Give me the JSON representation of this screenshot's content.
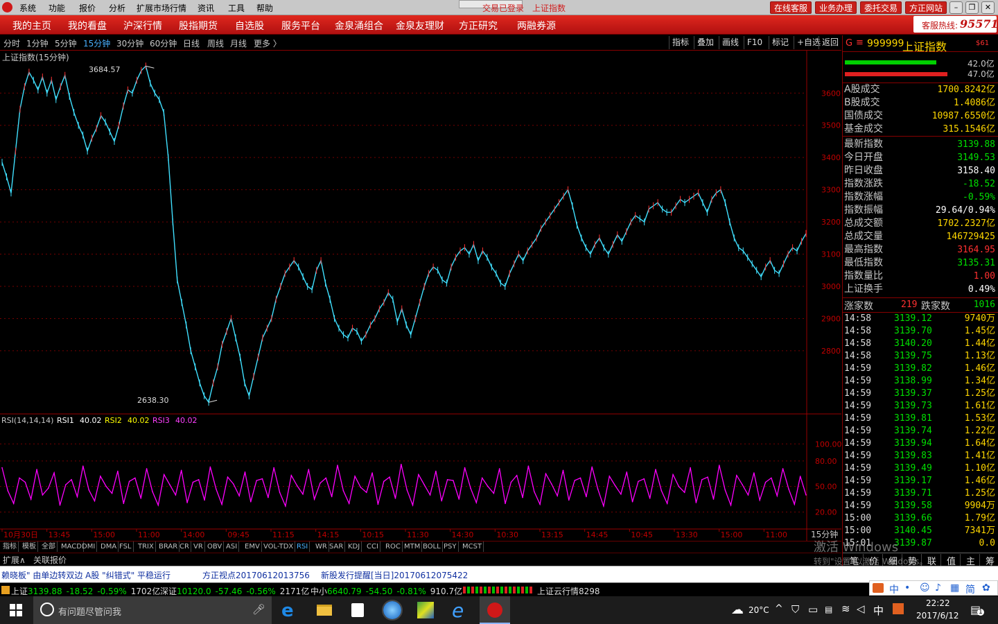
{
  "titlebar": {
    "menus": [
      "系统",
      "功能",
      "报价",
      "分析",
      "扩展市场行情",
      "资讯",
      "工具",
      "帮助"
    ],
    "status": "交易已登录",
    "current": "上证指数",
    "buttons": [
      "在线客服",
      "业务办理",
      "委托交易",
      "方正网站"
    ]
  },
  "nav": {
    "items": [
      "我的主页",
      "我的看盘",
      "沪深行情",
      "股指期货",
      "自选股",
      "服务平台",
      "金泉涌组合",
      "金泉友理财",
      "方正研究",
      "两融券源"
    ],
    "hotline_label": "客服热线:",
    "hotline": "95571"
  },
  "periods": {
    "items": [
      "分时",
      "1分钟",
      "5分钟",
      "15分钟",
      "30分钟",
      "60分钟",
      "日线",
      "周线",
      "月线",
      "更多 〉"
    ],
    "active": "15分钟",
    "tools": [
      "指标",
      "叠加",
      "画线",
      "F10",
      "标记",
      "+自选",
      "返回"
    ]
  },
  "chart_data": [
    {
      "type": "line",
      "title": "上证指数(15分钟)",
      "ylim": [
        2638.3,
        3684.57
      ],
      "yticks": [
        2800,
        2900,
        3000,
        3100,
        3200,
        3300,
        3400,
        3500,
        3600
      ],
      "high_label": "3684.57",
      "low_label": "2638.30",
      "x": [
        "10月30日",
        "13:45",
        "15:00",
        "11:00",
        "14:00",
        "09:45",
        "11:15",
        "14:15",
        "10:15",
        "11:30",
        "14:30",
        "10:30",
        "13:15",
        "14:45",
        "10:45",
        "13:30",
        "15:00",
        "11:00"
      ],
      "period_label": "15分钟",
      "series": [
        {
          "values": [
            3385,
            3340,
            3290,
            3420,
            3550,
            3620,
            3665,
            3640,
            3610,
            3650,
            3600,
            3640,
            3580,
            3620,
            3655,
            3590,
            3540,
            3500,
            3470,
            3420,
            3460,
            3490,
            3530,
            3510,
            3480,
            3450,
            3500,
            3560,
            3610,
            3600,
            3640,
            3670,
            3684,
            3630,
            3600,
            3580,
            3540,
            3400,
            3200,
            3020,
            2950,
            2880,
            2800,
            2750,
            2700,
            2660,
            2640,
            2700,
            2750,
            2820,
            2860,
            2900,
            2840,
            2780,
            2700,
            2660,
            2720,
            2780,
            2840,
            2870,
            2900,
            2960,
            3000,
            3040,
            3060,
            3080,
            3060,
            3030,
            3000,
            2990,
            3050,
            3080,
            3010,
            2960,
            2900,
            2870,
            2850,
            2840,
            2870,
            2860,
            2830,
            2850,
            2880,
            2900,
            2930,
            2950,
            2980,
            2960,
            2890,
            2930,
            2880,
            2850,
            2900,
            2950,
            3000,
            3040,
            3060,
            3050,
            3020,
            3010,
            3060,
            3090,
            3110,
            3120,
            3100,
            3130,
            3080,
            3110,
            3090,
            3060,
            3040,
            3010,
            3000,
            3040,
            3070,
            3100,
            3080,
            3110,
            3130,
            3150,
            3180,
            3200,
            3220,
            3240,
            3260,
            3280,
            3300,
            3250,
            3190,
            3150,
            3120,
            3100,
            3130,
            3150,
            3120,
            3100,
            3130,
            3160,
            3140,
            3170,
            3200,
            3220,
            3210,
            3200,
            3240,
            3250,
            3260,
            3240,
            3230,
            3230,
            3250,
            3270,
            3260,
            3270,
            3280,
            3290,
            3260,
            3230,
            3270,
            3290,
            3300,
            3260,
            3200,
            3150,
            3120,
            3110,
            3090,
            3070,
            3050,
            3030,
            3060,
            3080,
            3050,
            3040,
            3070,
            3100,
            3120,
            3110,
            3140,
            3164
          ]
        }
      ]
    },
    {
      "type": "line",
      "title": "RSI(14,14,14)",
      "legend": [
        {
          "name": "RSI1",
          "value": "40.02",
          "color": "#ffffff"
        },
        {
          "name": "RSI2",
          "value": "40.02",
          "color": "#ffff00"
        },
        {
          "name": "RSI3",
          "value": "40.02",
          "color": "#ff00ff"
        }
      ],
      "ylim": [
        0,
        110
      ],
      "yticks": [
        20,
        50,
        80,
        100
      ],
      "series": [
        {
          "name": "RSI3",
          "values": [
            72,
            45,
            30,
            60,
            55,
            35,
            70,
            40,
            48,
            66,
            28,
            52,
            58,
            38,
            74,
            46,
            33,
            62,
            50,
            42,
            68,
            30,
            56,
            60,
            36,
            71,
            44,
            28,
            64,
            52,
            40,
            69,
            31,
            55,
            58,
            34,
            73,
            47,
            29,
            61,
            53,
            39,
            67,
            32,
            57,
            59,
            37,
            72,
            43,
            27,
            63,
            51,
            41,
            70,
            35,
            54,
            60,
            38,
            75,
            45,
            30,
            62,
            49,
            43,
            66,
            29,
            56,
            61,
            36,
            76,
            46,
            28,
            64,
            52,
            40,
            68,
            33,
            58,
            57,
            35,
            72,
            48,
            31,
            60,
            50,
            42,
            71,
            30,
            55,
            63,
            37,
            74,
            44,
            29,
            65,
            53,
            39,
            69,
            34,
            57,
            60,
            38,
            73,
            47,
            27,
            62,
            51,
            41,
            67,
            32,
            56,
            59,
            36,
            70,
            45,
            30,
            64,
            50,
            43,
            72,
            31,
            58,
            61,
            35,
            75,
            46,
            28,
            63,
            52,
            40,
            66,
            34,
            55,
            60,
            39,
            71,
            47,
            29,
            62,
            40
          ]
        }
      ]
    }
  ],
  "indicators": [
    "指标",
    "模板",
    "全部",
    "MACD",
    "DMI",
    "DMA",
    "FSL",
    "TRIX",
    "BRAR",
    "CR",
    "VR",
    "OBV",
    "ASI",
    "EMV",
    "VOL-TDX",
    "RSI",
    "WR",
    "SAR",
    "KDJ",
    "CCI",
    "ROC",
    "MTM",
    "BOLL",
    "PSY",
    "MCST"
  ],
  "indicators_active": "RSI",
  "bottom_tabs": [
    "扩展∧",
    "关联报价"
  ],
  "side": {
    "code_prefix": "G",
    "code": "999999",
    "name": "上证指数",
    "badge": "$61",
    "bars": [
      {
        "label": "42.0亿",
        "color": "#00d000"
      },
      {
        "label": "47.0亿",
        "color": "#e02020"
      }
    ],
    "turnover": [
      {
        "k": "A股成交",
        "v": "1700.8242亿"
      },
      {
        "k": "B股成交",
        "v": "1.4086亿"
      },
      {
        "k": "国债成交",
        "v": "10987.6550亿"
      },
      {
        "k": "基金成交",
        "v": "315.1546亿"
      }
    ],
    "stats": [
      {
        "k": "最新指数",
        "v": "3139.88",
        "c": "#00e000"
      },
      {
        "k": "今日开盘",
        "v": "3149.53",
        "c": "#00e000"
      },
      {
        "k": "昨日收盘",
        "v": "3158.40",
        "c": "#ffffff"
      },
      {
        "k": "指数涨跌",
        "v": "-18.52",
        "c": "#00e000"
      },
      {
        "k": "指数涨幅",
        "v": "-0.59%",
        "c": "#00e000"
      },
      {
        "k": "指数振幅",
        "v": "29.64/0.94%",
        "c": "#ffffff"
      },
      {
        "k": "总成交额",
        "v": "1702.2327亿",
        "c": "#ffd700"
      },
      {
        "k": "总成交量",
        "v": "146729425",
        "c": "#ffd700"
      },
      {
        "k": "最高指数",
        "v": "3164.95",
        "c": "#ff3030"
      },
      {
        "k": "最低指数",
        "v": "3135.31",
        "c": "#00e000"
      },
      {
        "k": "指数量比",
        "v": "1.00",
        "c": "#ff3030"
      },
      {
        "k": "上证换手",
        "v": "0.49%",
        "c": "#ffffff"
      }
    ],
    "up_label": "涨家数",
    "up": "219",
    "down_label": "跌家数",
    "down": "1016",
    "ticks": [
      {
        "t": "14:58",
        "p": "3139.12",
        "v": "9740万"
      },
      {
        "t": "14:58",
        "p": "3139.70",
        "v": "1.45亿"
      },
      {
        "t": "14:58",
        "p": "3140.20",
        "v": "1.44亿"
      },
      {
        "t": "14:58",
        "p": "3139.75",
        "v": "1.13亿"
      },
      {
        "t": "14:59",
        "p": "3139.82",
        "v": "1.46亿"
      },
      {
        "t": "14:59",
        "p": "3138.99",
        "v": "1.34亿"
      },
      {
        "t": "14:59",
        "p": "3139.37",
        "v": "1.25亿"
      },
      {
        "t": "14:59",
        "p": "3139.73",
        "v": "1.61亿"
      },
      {
        "t": "14:59",
        "p": "3139.81",
        "v": "1.53亿"
      },
      {
        "t": "14:59",
        "p": "3139.74",
        "v": "1.22亿"
      },
      {
        "t": "14:59",
        "p": "3139.94",
        "v": "1.64亿"
      },
      {
        "t": "14:59",
        "p": "3139.83",
        "v": "1.41亿"
      },
      {
        "t": "14:59",
        "p": "3139.49",
        "v": "1.10亿"
      },
      {
        "t": "14:59",
        "p": "3139.17",
        "v": "1.46亿"
      },
      {
        "t": "14:59",
        "p": "3139.71",
        "v": "1.25亿"
      },
      {
        "t": "14:59",
        "p": "3139.58",
        "v": "9904万"
      },
      {
        "t": "15:00",
        "p": "3139.66",
        "v": "1.79亿"
      },
      {
        "t": "15:00",
        "p": "3140.45",
        "v": "7341万"
      },
      {
        "t": "15:01",
        "p": "3139.87",
        "v": "0.0"
      }
    ],
    "tabs": [
      "笔",
      "价",
      "细",
      "势",
      "联",
      "值",
      "主",
      "筹"
    ]
  },
  "watermark": {
    "line1": "激活 Windows",
    "line2": "转到\"设置\"以激活 Windows。"
  },
  "news": [
    "赖晓板\" 由单边转双边 A股 \"纠错式\" 平稳运行",
    "方正视点20170612013756",
    "新股发行提醒[当日]20170612075422"
  ],
  "quotes": [
    {
      "name": "上证",
      "price": "3139.88",
      "chg": "-18.52",
      "pct": "-0.59%",
      "amt": "1702亿"
    },
    {
      "name": "深证",
      "price": "10120.0",
      "chg": "-57.46",
      "pct": "-0.56%",
      "amt": "2171亿"
    },
    {
      "name": "中小",
      "price": "6640.79",
      "chg": "-54.50",
      "pct": "-0.81%",
      "amt": "910.7亿"
    }
  ],
  "cloud": "上证云行情8298",
  "ime": [
    "中",
    "简"
  ],
  "taskbar": {
    "search_placeholder": "有问题尽管问我",
    "temp": "20°C",
    "input": "中",
    "time": "22:22",
    "date": "2017/6/12",
    "notify": "1"
  }
}
